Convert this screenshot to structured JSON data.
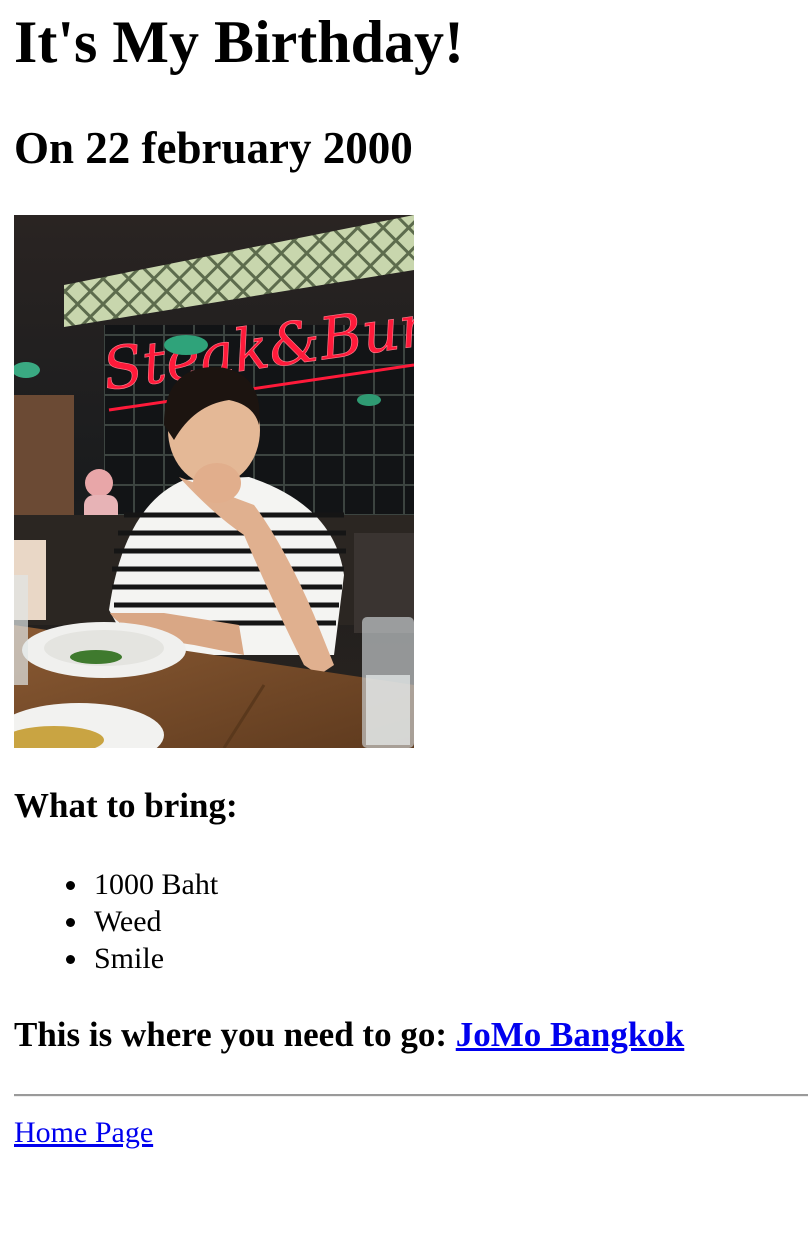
{
  "header": {
    "title": "It's My Birthday!",
    "date": "On 22 february 2000"
  },
  "photo": {
    "sign_text": "Steak & Burger",
    "icon": "birthday-photo"
  },
  "bring": {
    "heading": "What to bring:",
    "items": [
      "1000 Baht",
      "Weed",
      "Smile"
    ]
  },
  "where": {
    "prefix": "This is where you need to go:",
    "link_text": "JoMo Bangkok"
  },
  "footer": {
    "home_link": "Home Page"
  },
  "colors": {
    "link": "#0000ee",
    "text": "#000000",
    "neon": "#ff1a3a"
  }
}
